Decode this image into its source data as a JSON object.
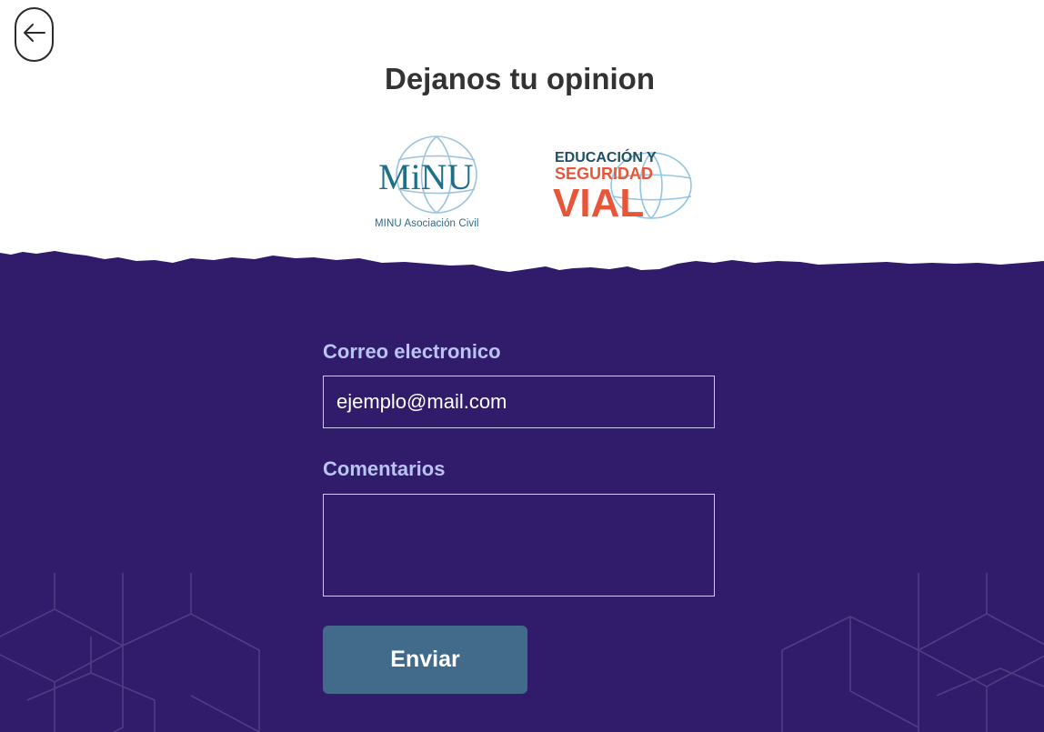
{
  "page": {
    "title": "Dejanos tu opinion"
  },
  "logos": {
    "minu": {
      "wordmark": "MiNU",
      "caption": "MINU Asociación Civil"
    },
    "vial": {
      "line1": "EDUCACIÓN Y",
      "line2": "SEGURIDAD",
      "line3": "VIAL"
    }
  },
  "form": {
    "email_label": "Correo electronico",
    "email_placeholder": "ejemplo@mail.com",
    "comments_label": "Comentarios",
    "comments_value": "",
    "submit_label": "Enviar"
  },
  "colors": {
    "background_purple": "#311b6b",
    "label_lavender": "#b9c4f3",
    "button_blue": "#426a8b",
    "vial_orange": "#e8563a",
    "educacion_teal": "#1f4f62"
  },
  "icons": {
    "back": "arrow-left-icon"
  }
}
